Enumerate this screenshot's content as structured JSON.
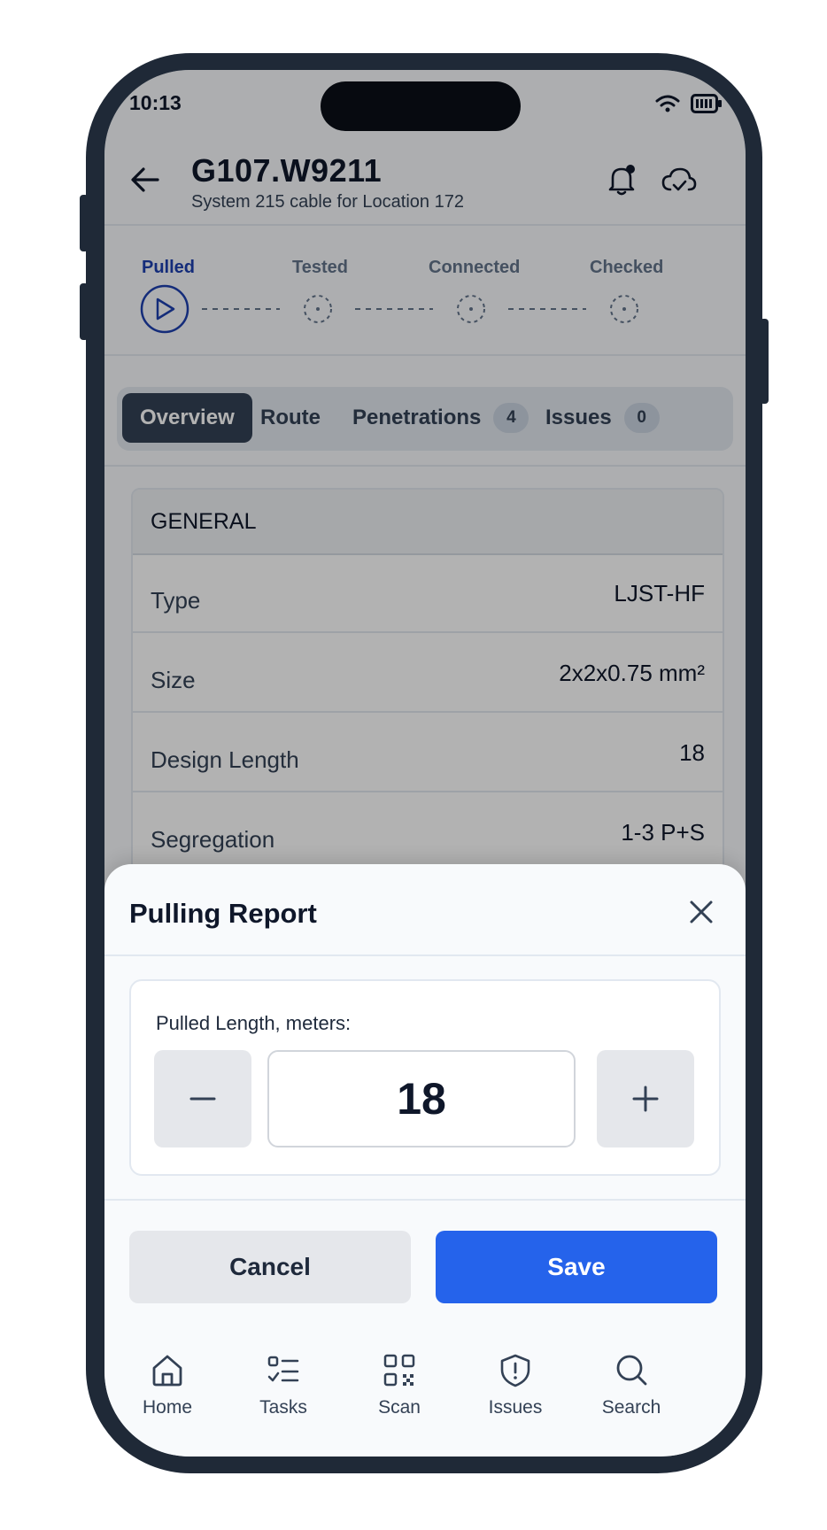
{
  "status_bar": {
    "time": "10:13"
  },
  "header": {
    "title": "G107.W9211",
    "subtitle": "System 215 cable for Location 172"
  },
  "steps": [
    {
      "label": "Pulled",
      "state": "active"
    },
    {
      "label": "Tested",
      "state": "pending"
    },
    {
      "label": "Connected",
      "state": "pending"
    },
    {
      "label": "Checked",
      "state": "pending"
    }
  ],
  "tabs": [
    {
      "label": "Overview",
      "active": true
    },
    {
      "label": "Route"
    },
    {
      "label": "Penetrations",
      "count": "4"
    },
    {
      "label": "Issues",
      "count": "0"
    }
  ],
  "general": {
    "heading": "GENERAL",
    "rows": [
      {
        "label": "Type",
        "value": "LJST-HF"
      },
      {
        "label": "Size",
        "value": "2x2x0.75 mm²"
      },
      {
        "label": "Design Length",
        "value": "18"
      },
      {
        "label": "Segregation",
        "value": "1-3 P+S"
      }
    ]
  },
  "modal": {
    "title": "Pulling Report",
    "field_label": "Pulled Length, meters:",
    "value": "18",
    "cancel_label": "Cancel",
    "save_label": "Save"
  },
  "bottom_nav": [
    {
      "label": "Home",
      "icon": "home-icon"
    },
    {
      "label": "Tasks",
      "icon": "tasks-icon"
    },
    {
      "label": "Scan",
      "icon": "qr-scan-icon"
    },
    {
      "label": "Issues",
      "icon": "shield-alert-icon"
    },
    {
      "label": "Search",
      "icon": "search-icon"
    }
  ],
  "colors": {
    "accent": "#2563eb",
    "active_step": "#1e40af",
    "phone_frame": "#1f2937"
  }
}
